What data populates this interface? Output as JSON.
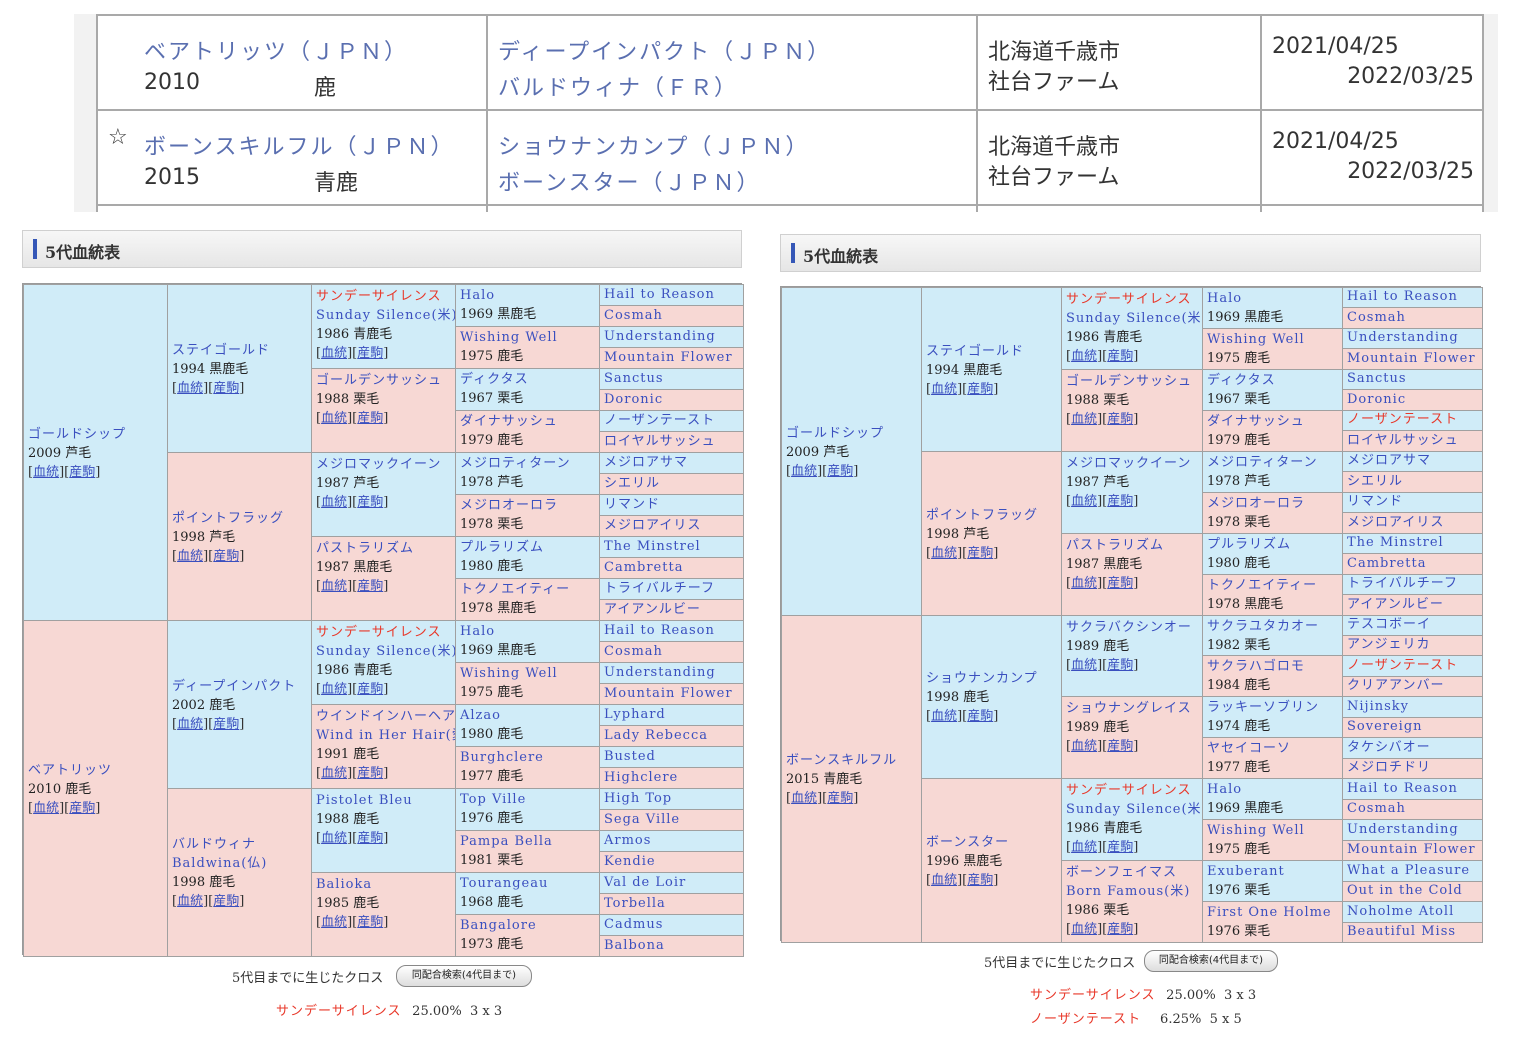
{
  "registrations": [
    {
      "star": "",
      "name": "ベアトリッツ（ＪＰＮ）",
      "year": "2010",
      "color": "鹿",
      "sire": "ディープインパクト（ＪＰＮ）",
      "dam": "バルドウィナ（ＦＲ）",
      "place1": "北海道千歳市",
      "place2": "社台ファーム",
      "date1": "2021/04/25",
      "date2": "2022/03/25"
    },
    {
      "star": "☆",
      "name": "ボーンスキルフル（ＪＰＮ）",
      "year": "2015",
      "color": "青鹿",
      "sire": "ショウナンカンプ（ＪＰＮ）",
      "dam": "ボーンスター（ＪＰＮ）",
      "place1": "北海道千歳市",
      "place2": "社台ファーム",
      "date1": "2021/04/25",
      "date2": "2022/03/25"
    }
  ],
  "links": {
    "bloodline": "血統",
    "foals": "産駒"
  },
  "pedigrees": [
    {
      "title": "5代血統表",
      "g1": [
        {
          "name": "ゴールドシップ",
          "info": "2009 芦毛"
        },
        {
          "name": "ベアトリッツ",
          "info": "2010 鹿毛"
        }
      ],
      "g2": [
        {
          "name": "ステイゴールド",
          "info": "1994 黒鹿毛"
        },
        {
          "name": "ポイントフラッグ",
          "info": "1998 芦毛"
        },
        {
          "name": "ディープインパクト",
          "info": "2002 鹿毛"
        },
        {
          "name": "バルドウィナ",
          "name2": "Baldwina(仏)",
          "info": "1998 鹿毛"
        }
      ],
      "g3": [
        {
          "name": "サンデーサイレンス",
          "name2": "Sunday Silence(米)",
          "info": "1986 青鹿毛",
          "red": true
        },
        {
          "name": "ゴールデンサッシュ",
          "info": "1988 栗毛"
        },
        {
          "name": "メジロマックイーン",
          "info": "1987 芦毛"
        },
        {
          "name": "パストラリズム",
          "info": "1987 黒鹿毛"
        },
        {
          "name": "サンデーサイレンス",
          "name2": "Sunday Silence(米)",
          "info": "1986 青鹿毛",
          "red": true
        },
        {
          "name": "ウインドインハーヘア",
          "name2": "Wind in Her Hair(愛)",
          "info": "1991 鹿毛"
        },
        {
          "name": "Pistolet Bleu",
          "info": "1988 鹿毛"
        },
        {
          "name": "Balioka",
          "info": "1985 鹿毛"
        }
      ],
      "g4": [
        {
          "name": "Halo",
          "info": "1969 黒鹿毛"
        },
        {
          "name": "Wishing Well",
          "info": "1975 鹿毛"
        },
        {
          "name": "ディクタス",
          "info": "1967 栗毛"
        },
        {
          "name": "ダイナサッシュ",
          "info": "1979 鹿毛"
        },
        {
          "name": "メジロティターン",
          "info": "1978 芦毛"
        },
        {
          "name": "メジロオーロラ",
          "info": "1978 栗毛"
        },
        {
          "name": "プルラリズム",
          "info": "1980 鹿毛"
        },
        {
          "name": "トクノエイティー",
          "info": "1978 黒鹿毛"
        },
        {
          "name": "Halo",
          "info": "1969 黒鹿毛"
        },
        {
          "name": "Wishing Well",
          "info": "1975 鹿毛"
        },
        {
          "name": "Alzao",
          "info": "1980 鹿毛"
        },
        {
          "name": "Burghclere",
          "info": "1977 鹿毛"
        },
        {
          "name": "Top Ville",
          "info": "1976 鹿毛"
        },
        {
          "name": "Pampa Bella",
          "info": "1981 栗毛"
        },
        {
          "name": "Tourangeau",
          "info": "1968 鹿毛"
        },
        {
          "name": "Bangalore",
          "info": "1973 鹿毛"
        }
      ],
      "g5": [
        {
          "name": "Hail to Reason"
        },
        {
          "name": "Cosmah"
        },
        {
          "name": "Understanding"
        },
        {
          "name": "Mountain Flower"
        },
        {
          "name": "Sanctus"
        },
        {
          "name": "Doronic"
        },
        {
          "name": "ノーザンテースト"
        },
        {
          "name": "ロイヤルサッシュ"
        },
        {
          "name": "メジロアサマ"
        },
        {
          "name": "シエリル"
        },
        {
          "name": "リマンド"
        },
        {
          "name": "メジロアイリス"
        },
        {
          "name": "The Minstrel"
        },
        {
          "name": "Cambretta"
        },
        {
          "name": "トライバルチーフ"
        },
        {
          "name": "アイアンルビー"
        },
        {
          "name": "Hail to Reason"
        },
        {
          "name": "Cosmah"
        },
        {
          "name": "Understanding"
        },
        {
          "name": "Mountain Flower"
        },
        {
          "name": "Lyphard"
        },
        {
          "name": "Lady Rebecca"
        },
        {
          "name": "Busted"
        },
        {
          "name": "Highclere"
        },
        {
          "name": "High Top"
        },
        {
          "name": "Sega Ville"
        },
        {
          "name": "Armos"
        },
        {
          "name": "Kendie"
        },
        {
          "name": "Val de Loir"
        },
        {
          "name": "Torbella"
        },
        {
          "name": "Cadmus"
        },
        {
          "name": "Balbona"
        }
      ],
      "cross_label": "5代目までに生じたクロス",
      "search_button": "同配合検索(4代目まで)",
      "crosses": [
        {
          "name": "サンデーサイレンス",
          "pct": "25.00%",
          "gen": "3 x 3"
        }
      ]
    },
    {
      "title": "5代血統表",
      "g1": [
        {
          "name": "ゴールドシップ",
          "info": "2009 芦毛"
        },
        {
          "name": "ボーンスキルフル",
          "info": "2015 青鹿毛"
        }
      ],
      "g2": [
        {
          "name": "ステイゴールド",
          "info": "1994 黒鹿毛"
        },
        {
          "name": "ポイントフラッグ",
          "info": "1998 芦毛"
        },
        {
          "name": "ショウナンカンプ",
          "info": "1998 鹿毛"
        },
        {
          "name": "ボーンスター",
          "info": "1996 黒鹿毛"
        }
      ],
      "g3": [
        {
          "name": "サンデーサイレンス",
          "name2": "Sunday Silence(米)",
          "info": "1986 青鹿毛",
          "red": true
        },
        {
          "name": "ゴールデンサッシュ",
          "info": "1988 栗毛"
        },
        {
          "name": "メジロマックイーン",
          "info": "1987 芦毛"
        },
        {
          "name": "パストラリズム",
          "info": "1987 黒鹿毛"
        },
        {
          "name": "サクラバクシンオー",
          "info": "1989 鹿毛"
        },
        {
          "name": "ショウナングレイス",
          "info": "1989 鹿毛"
        },
        {
          "name": "サンデーサイレンス",
          "name2": "Sunday Silence(米)",
          "info": "1986 青鹿毛",
          "red": true
        },
        {
          "name": "ボーンフェイマス",
          "name2": "Born Famous(米)",
          "info": "1986 栗毛"
        }
      ],
      "g4": [
        {
          "name": "Halo",
          "info": "1969 黒鹿毛"
        },
        {
          "name": "Wishing Well",
          "info": "1975 鹿毛"
        },
        {
          "name": "ディクタス",
          "info": "1967 栗毛"
        },
        {
          "name": "ダイナサッシュ",
          "info": "1979 鹿毛"
        },
        {
          "name": "メジロティターン",
          "info": "1978 芦毛"
        },
        {
          "name": "メジロオーロラ",
          "info": "1978 栗毛"
        },
        {
          "name": "プルラリズム",
          "info": "1980 鹿毛"
        },
        {
          "name": "トクノエイティー",
          "info": "1978 黒鹿毛"
        },
        {
          "name": "サクラユタカオー",
          "info": "1982 栗毛"
        },
        {
          "name": "サクラハゴロモ",
          "info": "1984 鹿毛"
        },
        {
          "name": "ラッキーソブリン",
          "info": "1974 鹿毛"
        },
        {
          "name": "ヤセイコーソ",
          "info": "1977 鹿毛"
        },
        {
          "name": "Halo",
          "info": "1969 黒鹿毛"
        },
        {
          "name": "Wishing Well",
          "info": "1975 鹿毛"
        },
        {
          "name": "Exuberant",
          "info": "1976 栗毛"
        },
        {
          "name": "First One Holme",
          "info": "1976 栗毛"
        }
      ],
      "g5": [
        {
          "name": "Hail to Reason"
        },
        {
          "name": "Cosmah"
        },
        {
          "name": "Understanding"
        },
        {
          "name": "Mountain Flower"
        },
        {
          "name": "Sanctus"
        },
        {
          "name": "Doronic"
        },
        {
          "name": "ノーザンテースト",
          "red": true
        },
        {
          "name": "ロイヤルサッシュ"
        },
        {
          "name": "メジロアサマ"
        },
        {
          "name": "シエリル"
        },
        {
          "name": "リマンド"
        },
        {
          "name": "メジロアイリス"
        },
        {
          "name": "The Minstrel"
        },
        {
          "name": "Cambretta"
        },
        {
          "name": "トライバルチーフ"
        },
        {
          "name": "アイアンルビー"
        },
        {
          "name": "テスコボーイ"
        },
        {
          "name": "アンジェリカ"
        },
        {
          "name": "ノーザンテースト",
          "red": true
        },
        {
          "name": "クリアアンバー"
        },
        {
          "name": "Nijinsky"
        },
        {
          "name": "Sovereign"
        },
        {
          "name": "タケシバオー"
        },
        {
          "name": "メジロチドリ"
        },
        {
          "name": "Hail to Reason"
        },
        {
          "name": "Cosmah"
        },
        {
          "name": "Understanding"
        },
        {
          "name": "Mountain Flower"
        },
        {
          "name": "What a Pleasure"
        },
        {
          "name": "Out in the Cold"
        },
        {
          "name": "Noholme Atoll"
        },
        {
          "name": "Beautiful Miss"
        }
      ],
      "cross_label": "5代目までに生じたクロス",
      "search_button": "同配合検索(4代目まで)",
      "crosses": [
        {
          "name": "サンデーサイレンス",
          "pct": "25.00%",
          "gen": "3 x 3"
        },
        {
          "name": "ノーザンテースト",
          "pct": "6.25%",
          "gen": "5 x 5"
        }
      ]
    }
  ]
}
